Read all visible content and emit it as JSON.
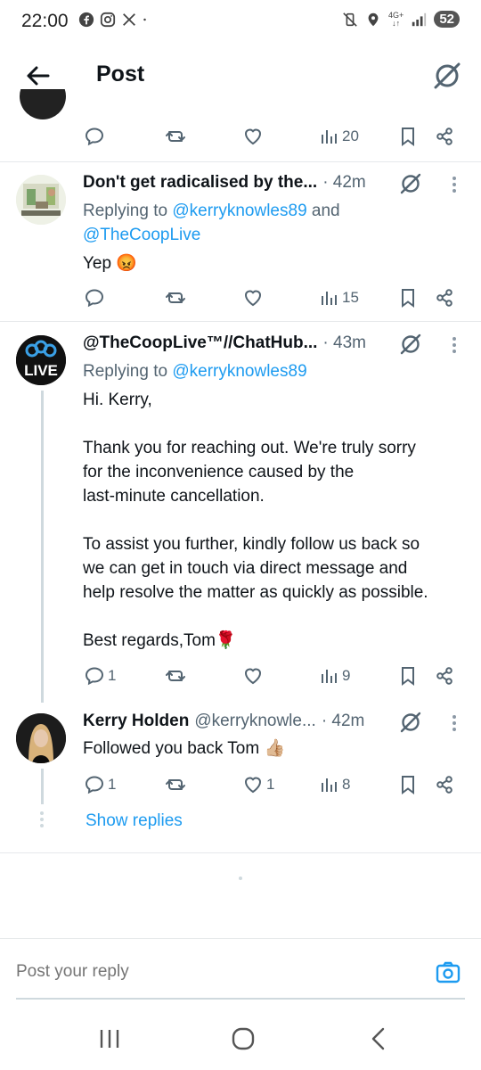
{
  "status_bar": {
    "time": "22:00",
    "left_icons": [
      "facebook-icon",
      "instagram-icon",
      "x-icon",
      "dot-icon"
    ],
    "right_icons": [
      "mute-vibrate-icon",
      "location-icon",
      "4g-icon",
      "signal-icon"
    ],
    "network_top": "4G+",
    "network_bottom": "↓↑",
    "battery": "52"
  },
  "header": {
    "title": "Post",
    "back_icon": "arrow-left-icon",
    "grok_icon": "grok-icon"
  },
  "top_tweet": {
    "views": "20"
  },
  "tweets": [
    {
      "name": "Don't get radicalised by the...",
      "handle": "",
      "time": "· 42m",
      "replying_prefix": "Replying to ",
      "mention1": "@kerryknowles89",
      "replying_and": " and",
      "mention2": "@TheCoopLive",
      "body": "Yep 😡",
      "replies": "",
      "likes": "",
      "views": "15"
    },
    {
      "name": "@TheCoopLive™//ChatHub...",
      "handle": "",
      "time": "· 43m",
      "replying_prefix": "Replying to ",
      "mention1": "@kerryknowles89",
      "body": "Hi. Kerry,\n\nThank you for reaching out. We're truly sorry\nfor the inconvenience caused by the\nlast-minute cancellation.\n\nTo assist you further, kindly follow us back so\nwe can get in touch via direct message and\nhelp resolve the matter as quickly as possible.\n\nBest regards,Tom🌹",
      "replies": "1",
      "likes": "",
      "views": "9",
      "avatar_text": "LIVE"
    },
    {
      "name": "Kerry Holden",
      "handle": "@kerryknowle...",
      "time": "· 42m",
      "body": "Followed you back Tom 👍🏼",
      "replies": "1",
      "likes": "1",
      "views": "8"
    }
  ],
  "show_replies": "Show replies",
  "reply_bar": {
    "placeholder": "Post your reply",
    "camera_icon": "camera-icon"
  },
  "nav": [
    "recents-icon",
    "home-icon",
    "back-icon"
  ],
  "colors": {
    "accent": "#1d9bf0",
    "muted": "#536471",
    "text": "#0f1419",
    "divider": "#e6e9eb"
  }
}
